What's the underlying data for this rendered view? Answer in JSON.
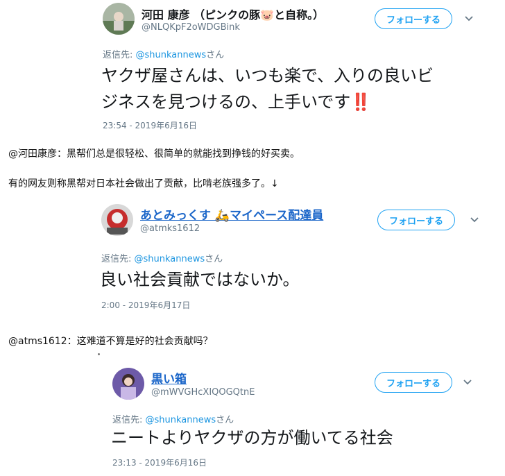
{
  "tweets": [
    {
      "name": "河田 康彦 （ピンクの豚🐷と自称。）",
      "handle": "@NLQKpF2oWDGBink",
      "follow_label": "フォローする",
      "reply_prefix": "返信先: ",
      "reply_to": "@shunkannews",
      "reply_suffix": "さん",
      "text_line1": "ヤクザ屋さんは、いつも楽で、入りの良いビ",
      "text_line2": "ジネスを見つけるの、上手いです‼️",
      "timestamp": "23:54 - 2019年6月16日"
    },
    {
      "name": "あとみっくす 🛵マイペース配達員",
      "handle": "@atmks1612",
      "follow_label": "フォローする",
      "reply_prefix": "返信先: ",
      "reply_to": "@shunkannews",
      "reply_suffix": "さん",
      "text_line1": "良い社会貢献ではないか。",
      "timestamp": "2:00 - 2019年6月17日"
    },
    {
      "name": "黒い箱",
      "handle": "@mWVGHcXIQOGQtnE",
      "follow_label": "フォローする",
      "reply_prefix": "返信先: ",
      "reply_to": "@shunkannews",
      "reply_suffix": "さん",
      "text_line1": "ニートよりヤクザの方が働いてる社会",
      "timestamp": "23:13 - 2019年6月16日"
    }
  ],
  "captions": {
    "c1": "@河田康彦：黑帮们总是很轻松、很简单的就能找到挣钱的好买卖。",
    "c2": "有的网友则称黑帮对日本社会做出了贡献，比啃老族强多了。↓",
    "c3": "@atms1612：这难道不算是好的社会贡献吗？"
  },
  "colors": {
    "accent": "#1da1f2",
    "link": "#1b66c9",
    "muted": "#657786"
  }
}
